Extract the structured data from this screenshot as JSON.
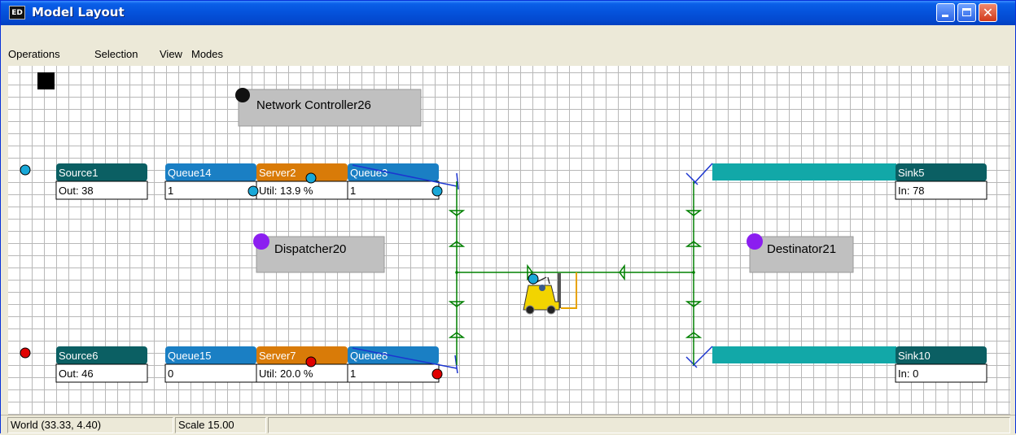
{
  "window": {
    "app_icon": "ED",
    "title": "Model Layout"
  },
  "menu": [
    "Operations",
    "Selection",
    "View",
    "Modes"
  ],
  "model": {
    "network_controller": "Network Controller26",
    "dispatcher": "Dispatcher20",
    "destinator": "Destinator21",
    "source1": {
      "name": "Source1",
      "stat": "Out: 38"
    },
    "queue14": {
      "name": "Queue14",
      "stat": "1"
    },
    "server2": {
      "name": "Server2",
      "stat": "Util: 13.9 %"
    },
    "queue3": {
      "name": "Queue3",
      "stat": "1"
    },
    "sink5": {
      "name": "Sink5",
      "stat": "In: 78"
    },
    "source6": {
      "name": "Source6",
      "stat": "Out: 46"
    },
    "queue15": {
      "name": "Queue15",
      "stat": "0"
    },
    "server7": {
      "name": "Server7",
      "stat": "Util: 20.0 %"
    },
    "queue8": {
      "name": "Queue8",
      "stat": "1"
    },
    "sink10": {
      "name": "Sink10",
      "stat": "In: 0"
    }
  },
  "colors": {
    "atom_header_dark": "#0b5f63",
    "queue_header": "#1a7fc4",
    "server_header": "#d97b08",
    "conveyor": "#12a8a8",
    "path": "#008000",
    "channel": "#1c35d0",
    "blue_dot": "#19a8d8",
    "red_dot": "#e00000",
    "purple_dot": "#8b1ef0",
    "black_dot": "#111111",
    "label_box": "#c0c0c0"
  },
  "status": {
    "world": "World (33.33, 4.40)",
    "scale": "Scale 15.00"
  }
}
